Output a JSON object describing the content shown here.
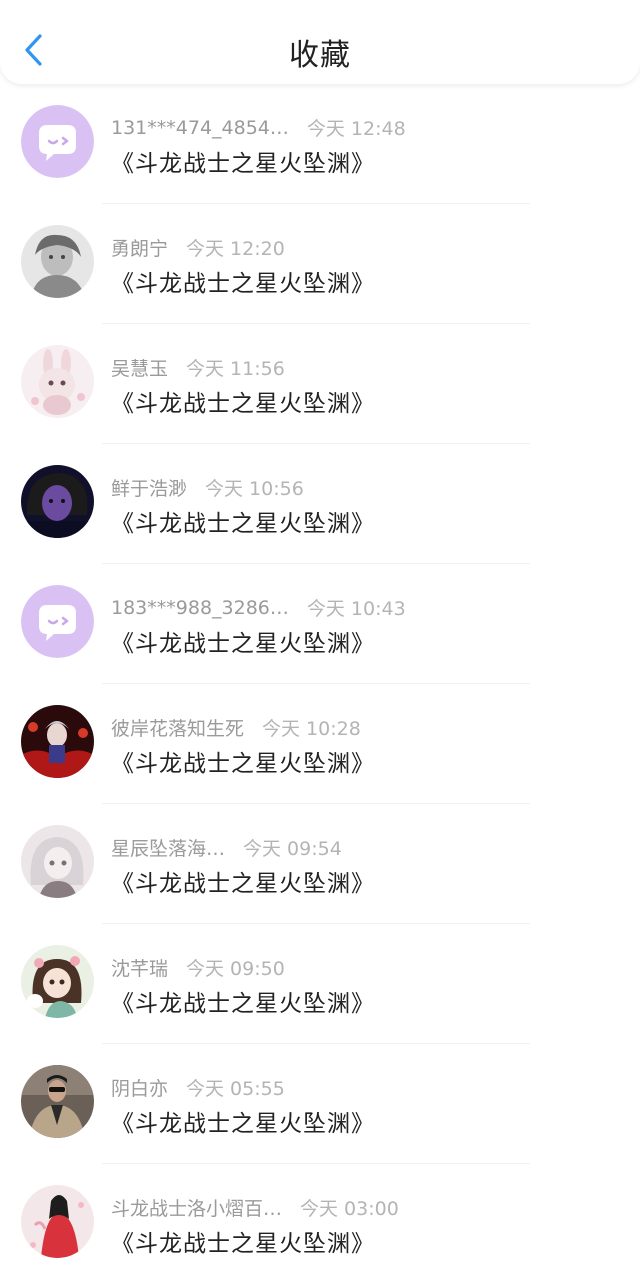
{
  "header": {
    "title": "收藏",
    "back_icon": "chevron-left-icon",
    "accent_color": "#2f95f0"
  },
  "favorites": [
    {
      "username": "131***474_4854…",
      "time": "今天 12:48",
      "title": "《斗龙战士之星火坠渊》",
      "avatar": "default-chat-avatar"
    },
    {
      "username": "勇朗宁",
      "time": "今天 12:20",
      "title": "《斗龙战士之星火坠渊》",
      "avatar": "photo-avatar"
    },
    {
      "username": "吴慧玉",
      "time": "今天 11:56",
      "title": "《斗龙战士之星火坠渊》",
      "avatar": "photo-avatar"
    },
    {
      "username": "鲜于浩渺",
      "time": "今天 10:56",
      "title": "《斗龙战士之星火坠渊》",
      "avatar": "photo-avatar"
    },
    {
      "username": "183***988_3286…",
      "time": "今天 10:43",
      "title": "《斗龙战士之星火坠渊》",
      "avatar": "default-chat-avatar"
    },
    {
      "username": "彼岸花落知生死",
      "time": "今天 10:28",
      "title": "《斗龙战士之星火坠渊》",
      "avatar": "photo-avatar"
    },
    {
      "username": "星辰坠落海…",
      "time": "今天 09:54",
      "title": "《斗龙战士之星火坠渊》",
      "avatar": "photo-avatar"
    },
    {
      "username": "沈芊瑞",
      "time": "今天 09:50",
      "title": "《斗龙战士之星火坠渊》",
      "avatar": "photo-avatar"
    },
    {
      "username": "阴白亦",
      "time": "今天 05:55",
      "title": "《斗龙战士之星火坠渊》",
      "avatar": "photo-avatar"
    },
    {
      "username": "斗龙战士洛小熠百…",
      "time": "今天 03:00",
      "title": "《斗龙战士之星火坠渊》",
      "avatar": "photo-avatar"
    }
  ]
}
